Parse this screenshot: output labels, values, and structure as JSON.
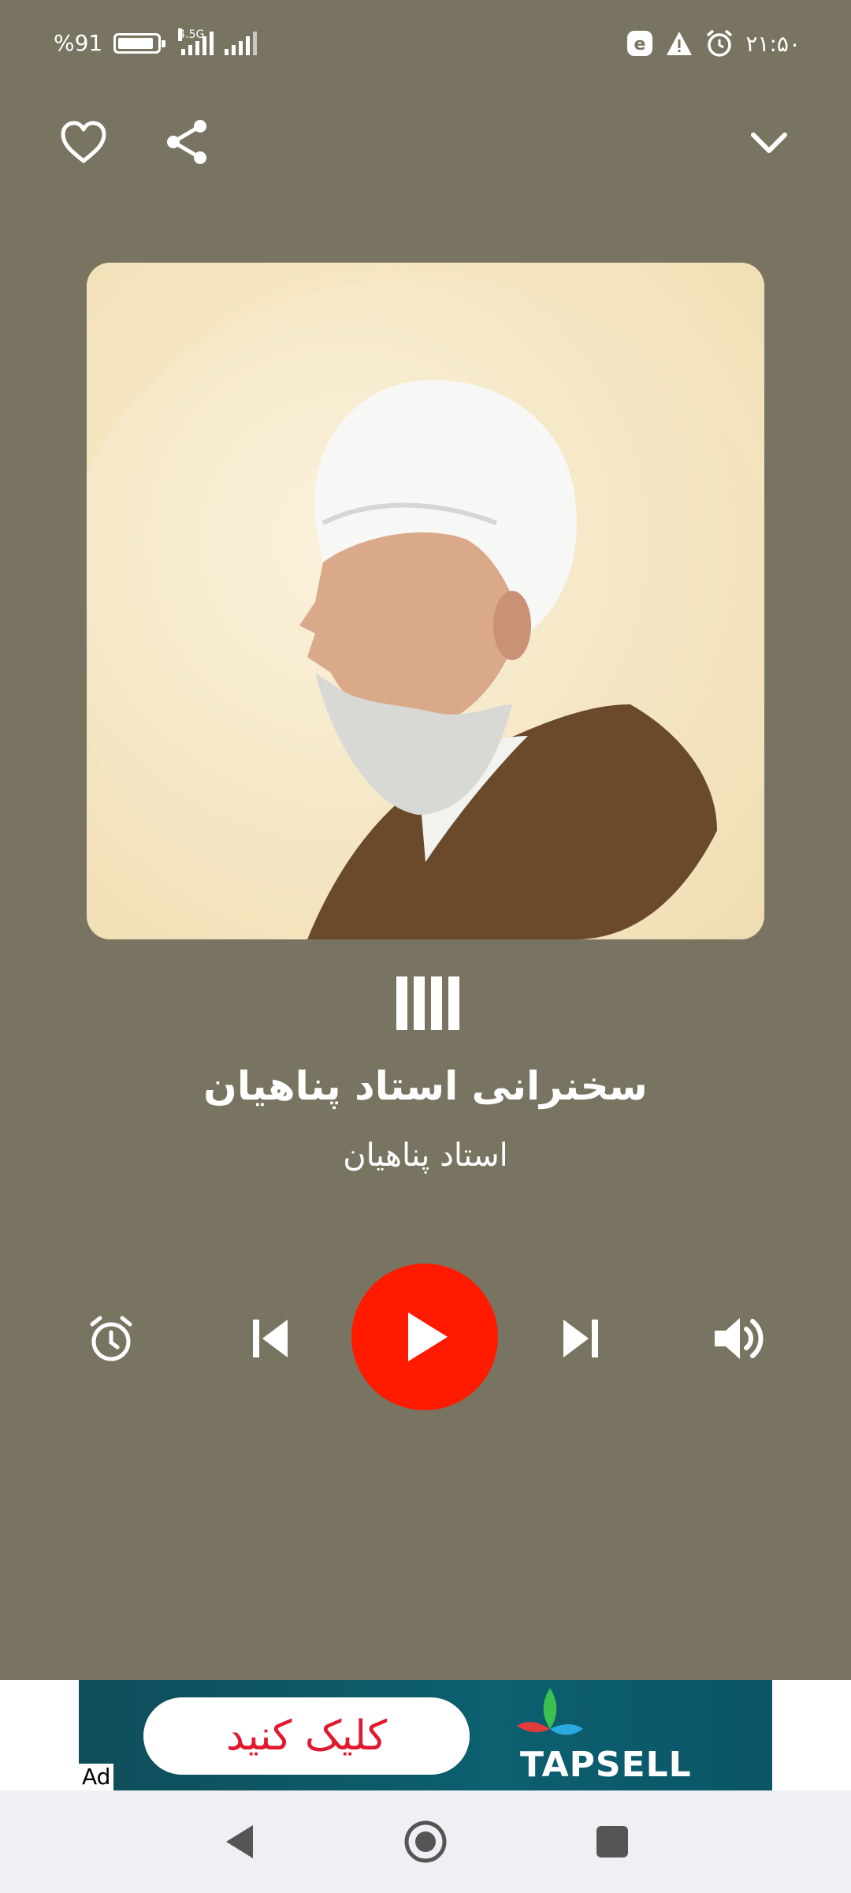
{
  "status_bar": {
    "battery_text": "%91",
    "battery_level": 0.91,
    "network_label": "4.5G",
    "time": "۲۱:۵۰"
  },
  "top_bar": {
    "icons": [
      "heart-icon",
      "share-icon",
      "chevron-down-icon"
    ]
  },
  "track": {
    "title": "سخنرانی استاد پناهیان",
    "artist": "استاد پناهیان"
  },
  "controls": {
    "icons": [
      "alarm-icon",
      "previous-icon",
      "play-icon",
      "next-icon",
      "volume-icon"
    ],
    "play_color": "#ff1a00"
  },
  "ad": {
    "button_label": "کلیک کنید",
    "brand": "TAPSELL",
    "tag": "Ad"
  },
  "colors": {
    "background": "#797461",
    "accent": "#ff1a00"
  }
}
